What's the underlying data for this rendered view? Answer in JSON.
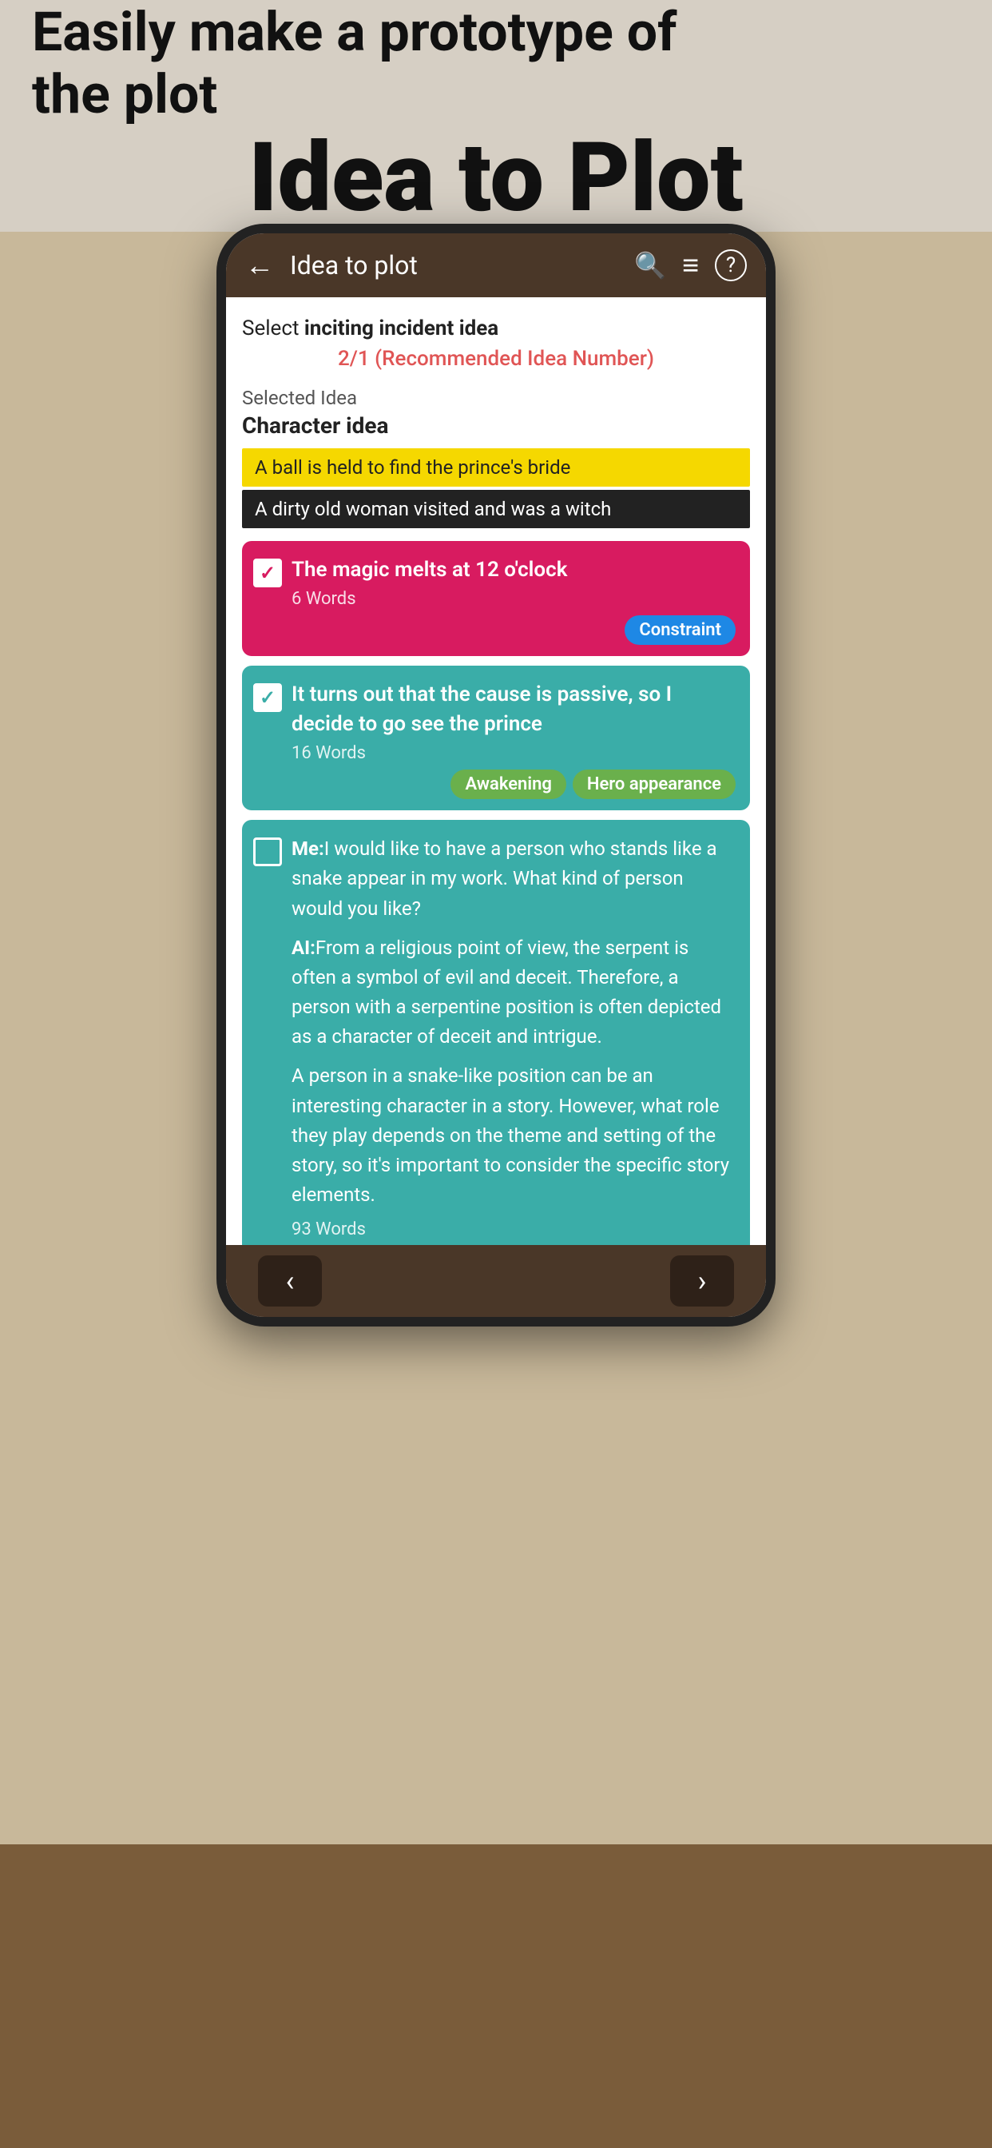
{
  "banner": {
    "subtitle": "Easily make a prototype of\nthe plot",
    "title": "Idea to Plot"
  },
  "appbar": {
    "title": "Idea to plot",
    "back_label": "←",
    "search_label": "🔍",
    "filter_label": "≡",
    "help_label": "?"
  },
  "content": {
    "section_label": "Select ",
    "section_bold": "inciting incident idea",
    "recommended": "2/1  (Recommended Idea Number)",
    "selected_idea_label": "Selected Idea",
    "selected_idea_value": "Character idea",
    "tag_yellow": "A ball is held to find the prince's bride",
    "tag_black": "A dirty old woman visited and was a witch"
  },
  "card1": {
    "text": "The magic melts at 12 o'clock",
    "words": "6 Words",
    "tag_label": "Constraint",
    "checked": true
  },
  "card2": {
    "text": "It turns out that the cause is passive, so I decide to go see the prince",
    "words": "16 Words",
    "tag1": "Awakening",
    "tag2": "Hero appearance",
    "checked": true
  },
  "card3": {
    "paragraph1_me": "Me:",
    "paragraph1_text": "I would like to have a person who stands like a snake appear in my work. What kind of person would you like?",
    "paragraph2_ai": "AI:",
    "paragraph2_text": "From a religious point of view, the serpent is often a symbol of evil and deceit. Therefore, a person with a serpentine position is often depicted as a character of deceit and intrigue.",
    "paragraph3_text": "A person in a snake-like position can be an interesting character in a story. However, what role they play depends on the theme and setting of the story, so it's important to consider the specific story elements.",
    "words": "93 Words",
    "checked": false
  },
  "nav": {
    "prev_label": "‹",
    "next_label": "›"
  }
}
